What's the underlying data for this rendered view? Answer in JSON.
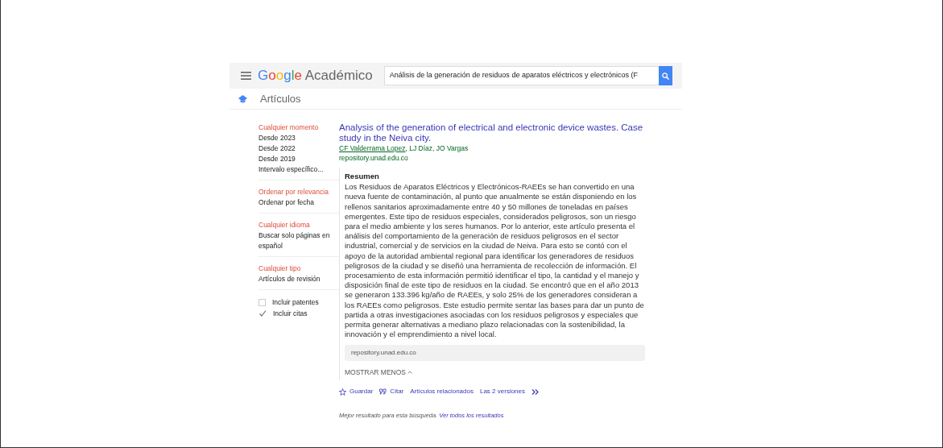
{
  "header": {
    "logo_brand": "Google",
    "logo_product": "Académico",
    "search": {
      "value": "Análisis de la generación de residuos de aparatos eléctricos y electrónicos (F"
    }
  },
  "section": {
    "title": "Artículos"
  },
  "sidebar": {
    "groups": [
      {
        "items": [
          {
            "label": "Cualquier momento",
            "selected": true
          },
          {
            "label": "Desde 2023",
            "selected": false
          },
          {
            "label": "Desde 2022",
            "selected": false
          },
          {
            "label": "Desde 2019",
            "selected": false
          },
          {
            "label": "Intervalo específico...",
            "selected": false
          }
        ]
      },
      {
        "items": [
          {
            "label": "Ordenar por relevancia",
            "selected": true
          },
          {
            "label": "Ordenar por fecha",
            "selected": false
          }
        ]
      },
      {
        "items": [
          {
            "label": "Cualquier idioma",
            "selected": true
          },
          {
            "label": "Buscar solo páginas en español",
            "selected": false
          }
        ]
      },
      {
        "items": [
          {
            "label": "Cualquier tipo",
            "selected": true
          },
          {
            "label": "Artículos de revisión",
            "selected": false
          }
        ]
      }
    ],
    "checkboxes": [
      {
        "label": "Incluir patentes",
        "checked": false
      },
      {
        "label": "Incluir citas",
        "checked": true
      }
    ]
  },
  "result": {
    "title": "Analysis of the generation of electrical and electronic device wastes. Case study in the Neiva city.",
    "authors": {
      "linked_name": "CF Valderrama Lopez",
      "rest": ", LJ Díaz, JO Vargas"
    },
    "source": "repository.unad.edu.co",
    "abstract_heading": "Resumen",
    "abstract": "Los Residuos de Aparatos Eléctricos y Electrónicos-RAEEs se han convertido en una nueva fuente de contaminación, al punto que anualmente se están disponiendo en los rellenos sanitarios aproximadamente entre 40 y 50 millones de toneladas en países emergentes. Este tipo de residuos especiales, considerados peligrosos, son un riesgo para el medio ambiente y los seres humanos. Por lo anterior, este artículo presenta el análisis del comportamiento de la generación de residuos peligrosos en el sector industrial, comercial y de servicios en la ciudad de Neiva. Para esto se contó con el apoyo de la autoridad ambiental regional para identificar los generadores de residuos peligrosos de la ciudad y se diseñó una herramienta de recolección de información. El procesamiento de esta información permitió identificar el tipo, la cantidad y el manejo y disposición final de este tipo de residuos en la ciudad. Se encontró que en el año 2013 se generaron 133.396 kg/año de RAEEs, y solo 25% de los generadores consideran a los RAEEs como peligrosos. Este estudio permite sentar las bases para dar un punto de partida a otras investigaciones asociadas con los residuos peligrosos y especiales que permita generar alternativas a mediano plazo relacionadas con la sostenibilidad, la innovación y el emprendimiento a nivel local.",
    "source_box": "repository.unad.edu.co",
    "toggle": "MOSTRAR MENOS",
    "actions": [
      {
        "kind": "save",
        "label": "Guardar"
      },
      {
        "kind": "cite",
        "label": "Citar"
      },
      {
        "kind": "plain",
        "label": "Artículos relacionados"
      },
      {
        "kind": "plain",
        "label": "Las 2 versiones"
      },
      {
        "kind": "more"
      }
    ]
  },
  "footer": {
    "note": "Mejor resultado para esta búsqueda.",
    "link": "Ver todos los resultados"
  }
}
